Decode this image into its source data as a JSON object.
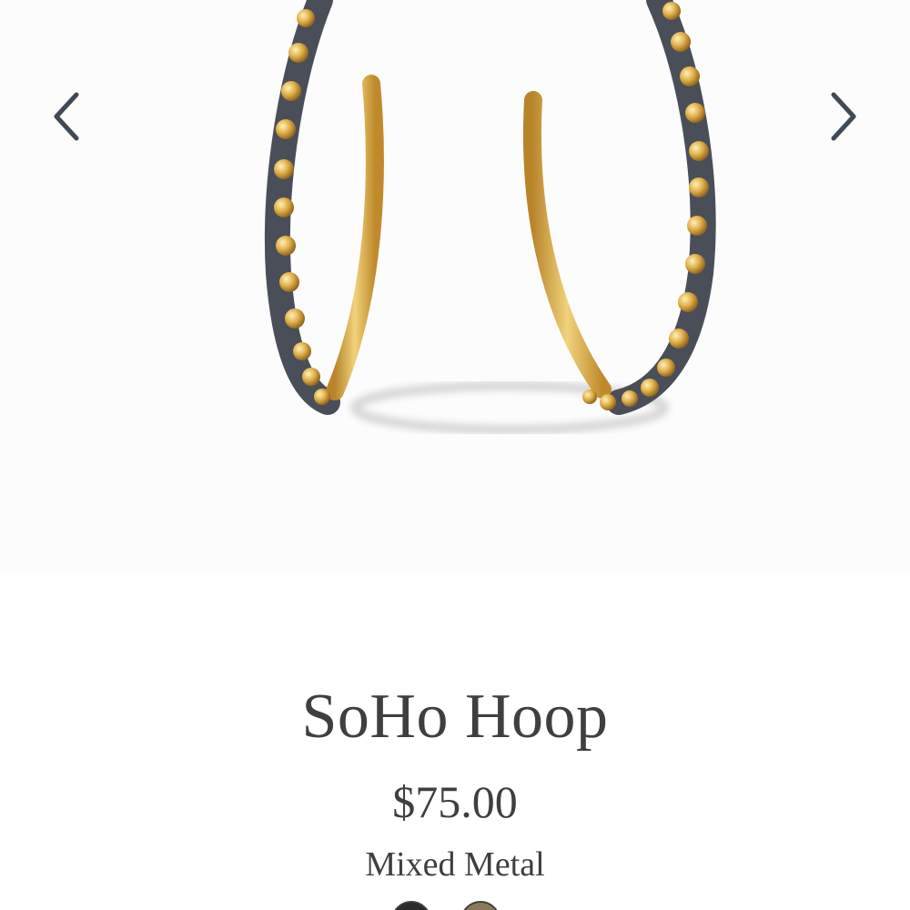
{
  "product": {
    "title": "SoHo Hoop",
    "price": "$75.00",
    "variant": "Mixed Metal"
  },
  "gallery": {
    "prev_icon": "chevron-left-icon",
    "next_icon": "chevron-right-icon"
  },
  "colors": {
    "gold": "#d9a93a",
    "gunmetal": "#4a4e58",
    "text": "#3f3f3f"
  }
}
